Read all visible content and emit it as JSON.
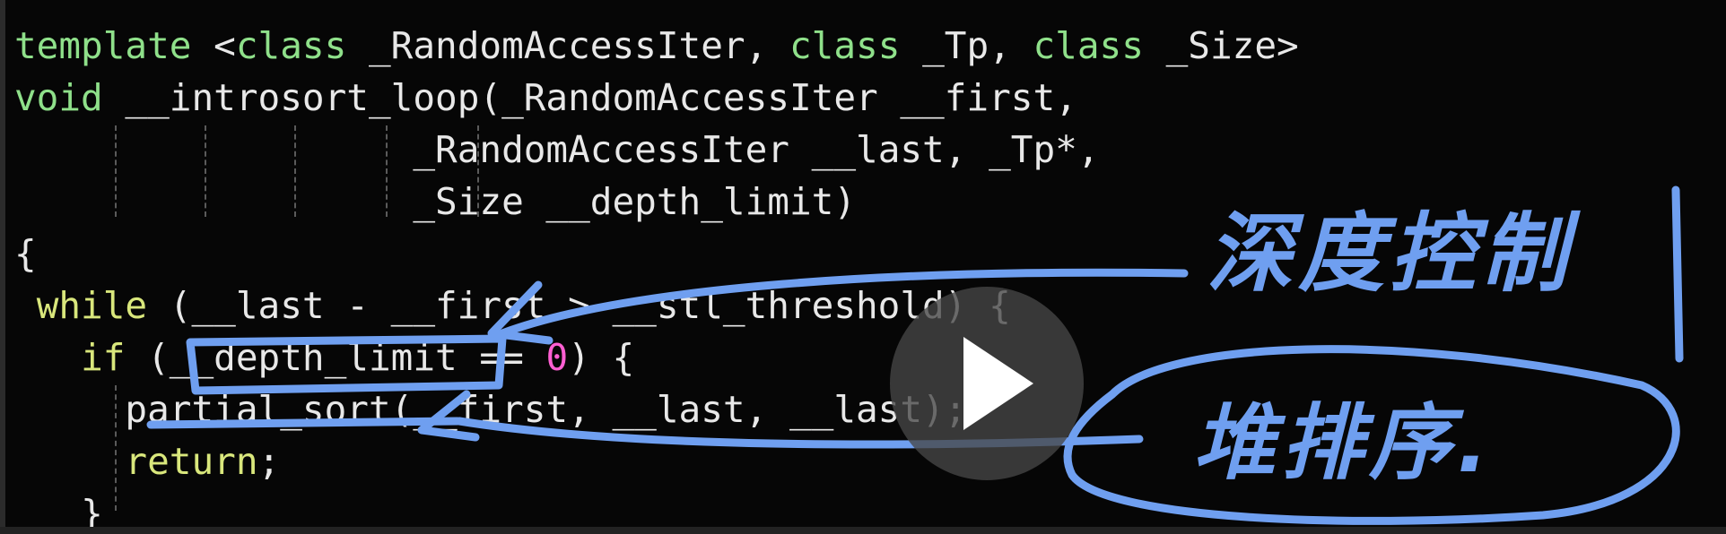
{
  "code_lines": [
    {
      "indent": "",
      "parts": [
        {
          "t": "template",
          "c": "kw2"
        },
        {
          "t": " <"
        },
        {
          "t": "class",
          "c": "kw2"
        },
        {
          "t": " _RandomAccessIter, "
        },
        {
          "t": "class",
          "c": "kw2"
        },
        {
          "t": " _Tp, "
        },
        {
          "t": "class",
          "c": "kw2"
        },
        {
          "t": " _Size>"
        }
      ]
    },
    {
      "indent": "",
      "parts": [
        {
          "t": "void",
          "c": "kw2"
        },
        {
          "t": " __introsort_loop(_RandomAccessIter __first,"
        }
      ]
    },
    {
      "indent": "                  ",
      "parts": [
        {
          "t": "_RandomAccessIter __last, _Tp*,"
        }
      ]
    },
    {
      "indent": "                  ",
      "parts": [
        {
          "t": "_Size __depth_limit)"
        }
      ]
    },
    {
      "indent": "",
      "parts": [
        {
          "t": "{"
        }
      ]
    },
    {
      "indent": " ",
      "parts": [
        {
          "t": "while",
          "c": "kw"
        },
        {
          "t": " (__last - __first > __stl_threshold) {"
        }
      ]
    },
    {
      "indent": "   ",
      "parts": [
        {
          "t": "if",
          "c": "kw"
        },
        {
          "t": " (__depth_limit == "
        },
        {
          "t": "0",
          "c": "num"
        },
        {
          "t": ") {"
        }
      ]
    },
    {
      "indent": "     ",
      "parts": [
        {
          "t": "partial_sort(__first, __last, __last);"
        }
      ]
    },
    {
      "indent": "     ",
      "parts": [
        {
          "t": "return",
          "c": "kw"
        },
        {
          "t": ";"
        }
      ]
    },
    {
      "indent": "   ",
      "parts": [
        {
          "t": "}"
        }
      ]
    }
  ],
  "annotations": {
    "top": "深度控制",
    "bottom": "堆排序."
  },
  "colors": {
    "ink": "#6f9ff0",
    "keyword_yellow": "#d9e77c",
    "keyword_green": "#8fe08a",
    "number": "#ff5fd2"
  },
  "icons": {
    "play": "play-icon"
  }
}
